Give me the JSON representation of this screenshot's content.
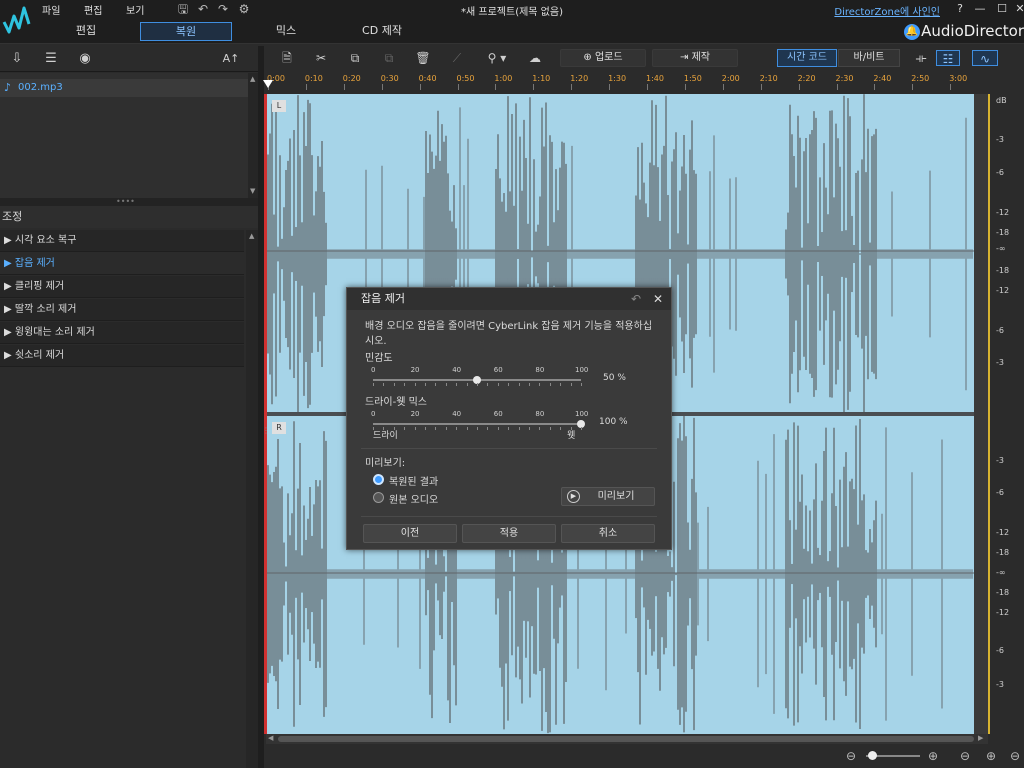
{
  "menu": {
    "file": "파일",
    "edit": "편집",
    "view": "보기"
  },
  "window": {
    "project_title": "*새 프로젝트(제목 없음)",
    "signin": "DirectorZone에 사인인",
    "help": "?"
  },
  "modes": {
    "edit": "편집",
    "restore": "복원",
    "mix": "믹스",
    "cd": "CD 제작"
  },
  "brand": "AudioDirector",
  "left": {
    "font_button": "A↑",
    "media_file": "002.mp3",
    "adjust_title": "조정",
    "adjust_items": [
      "시각 요소 복구",
      "잡음 제거",
      "클리핑 제거",
      "딸깍 소리 제거",
      "윙윙대는 소리 제거",
      "쉿소리 제거"
    ]
  },
  "toolbar": {
    "upload": "업로드",
    "produce": "제작",
    "timecode": "시간 코드",
    "bar_beat": "바/비트"
  },
  "ruler": [
    "0:00",
    "0:10",
    "0:20",
    "0:30",
    "0:40",
    "0:50",
    "1:00",
    "1:10",
    "1:20",
    "1:30",
    "1:40",
    "1:50",
    "2:00",
    "2:10",
    "2:20",
    "2:30",
    "2:40",
    "2:50",
    "3:00"
  ],
  "channels": {
    "left": "L",
    "right": "R"
  },
  "db_scale": {
    "top": [
      "dB",
      "-3",
      "-6",
      "-12",
      "-18",
      "-∞",
      "-18",
      "-12",
      "-6",
      "-3"
    ],
    "bottom": [
      "-3",
      "-6",
      "-12",
      "-18",
      "-∞",
      "-18",
      "-12",
      "-6",
      "-3"
    ]
  },
  "dialog": {
    "title": "잡음 제거",
    "description": "배경 오디오 잡음을 줄이려면 CyberLink 잡음 제거 기능을 적용하십시오.",
    "sensitivity_label": "민감도",
    "sensitivity_value": "50 %",
    "sensitivity_level": 50,
    "drywet_label": "드라이-웻 믹스",
    "drywet_value": "100 %",
    "drywet_level": 100,
    "scale": [
      "0",
      "20",
      "40",
      "60",
      "80",
      "100"
    ],
    "dry": "드라이",
    "wet": "웻",
    "preview_label": "미리보기:",
    "option_restored": "복원된 결과",
    "option_original": "원본 오디오",
    "preview_button": "미리보기",
    "prev_button": "이전",
    "apply_button": "적용",
    "cancel_button": "취소"
  },
  "colors": {
    "accent": "#3f9bff",
    "waveform_bg": "#a6d4e8",
    "ruler_text": "#e8a33c",
    "wave": "#5a5f63"
  }
}
